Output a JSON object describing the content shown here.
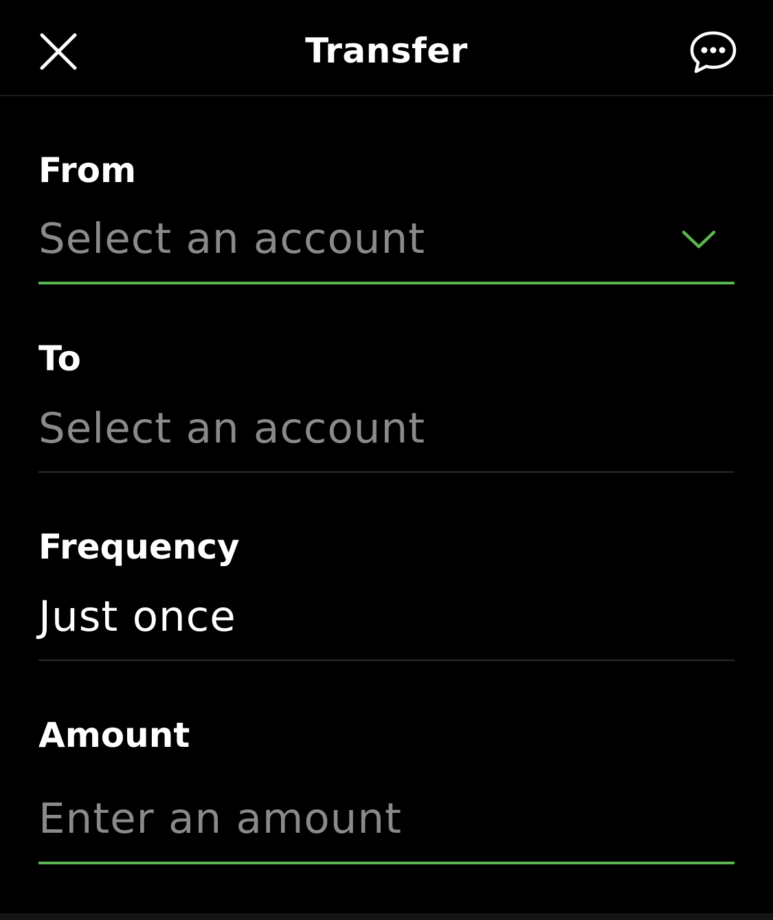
{
  "header": {
    "title": "Transfer",
    "close_icon": "close-icon",
    "chat_icon": "chat-bubble-icon"
  },
  "form": {
    "from": {
      "label": "From",
      "placeholder": "Select an account",
      "icon": "chevron-down-icon"
    },
    "to": {
      "label": "To",
      "placeholder": "Select an account"
    },
    "frequency": {
      "label": "Frequency",
      "value": "Just once"
    },
    "amount": {
      "label": "Amount",
      "placeholder": "Enter an amount"
    }
  },
  "colors": {
    "background": "#000000",
    "accent": "#5bb550",
    "placeholder": "#8a8a8a",
    "divider": "#2a2a2a"
  }
}
